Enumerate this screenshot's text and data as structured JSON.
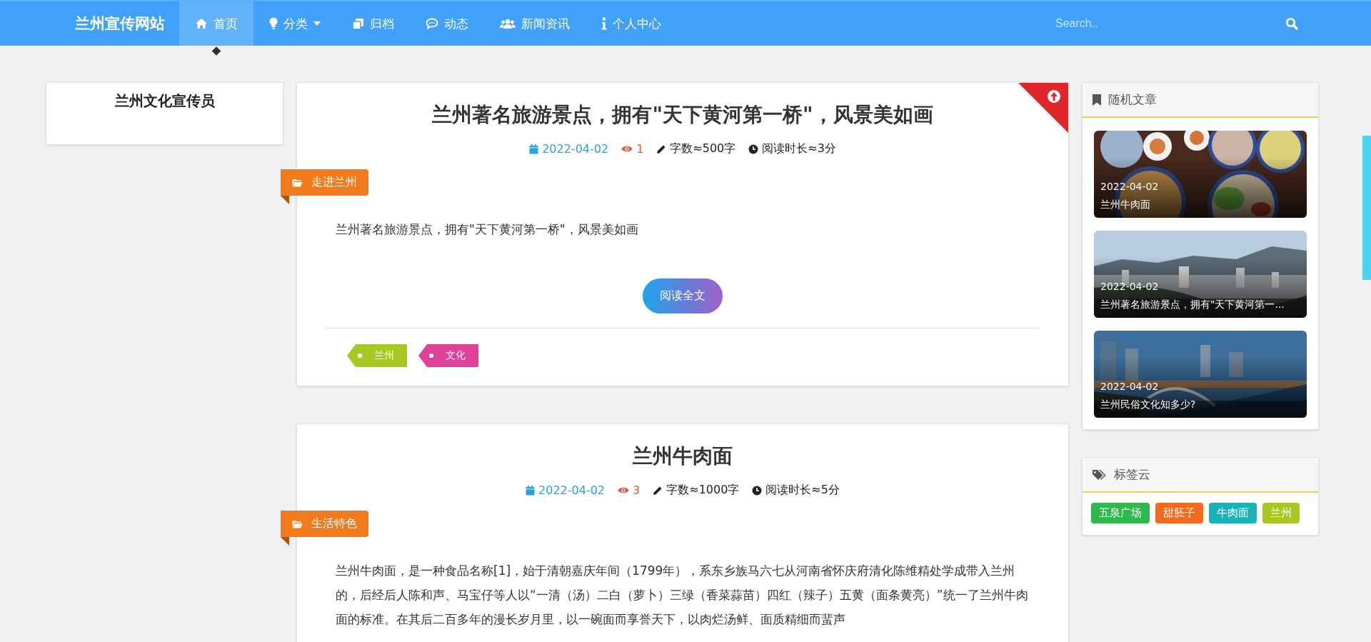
{
  "navbar": {
    "brand": "兰州宣传网站",
    "items": [
      {
        "label": "首页",
        "selected": true,
        "dropdown": false
      },
      {
        "label": "分类",
        "selected": false,
        "dropdown": true
      },
      {
        "label": "归档",
        "selected": false,
        "dropdown": false
      },
      {
        "label": "动态",
        "selected": false,
        "dropdown": false
      },
      {
        "label": "新闻资讯",
        "selected": false,
        "dropdown": false
      },
      {
        "label": "个人中心",
        "selected": false,
        "dropdown": false
      }
    ],
    "search": {
      "placeholder": "Search.."
    }
  },
  "profile": {
    "name": "兰州文化宣传员"
  },
  "articles": [
    {
      "title": "兰州著名旅游景点，拥有\"天下黄河第一桥\"，风景美如画",
      "pinned": true,
      "date": "2022-04-02",
      "views": "1",
      "words": "字数≈500字",
      "reading_time": "阅读时长≈3分",
      "category": "走进兰州",
      "excerpt": "兰州著名旅游景点，拥有\"天下黄河第一桥\"，风景美如画",
      "button": "阅读全文",
      "tags": [
        {
          "label": "兰州",
          "color": "#a8c720"
        },
        {
          "label": "文化",
          "color": "#e0409a"
        }
      ]
    },
    {
      "title": "兰州牛肉面",
      "pinned": false,
      "date": "2022-04-02",
      "views": "3",
      "words": "字数≈1000字",
      "reading_time": "阅读时长≈5分",
      "category": "生活特色",
      "excerpt": "兰州牛肉面，是一种食品名称[1]，始于清朝嘉庆年间（1799年），系东乡族马六七从河南省怀庆府清化陈维精处学成带入兰州的，后经后人陈和声、马宝仔等人以“一清（汤）二白（萝卜）三绿（香菜蒜苗）四红（辣子）五黄（面条黄亮）”统一了兰州牛肉面的标准。在其后二百多年的漫长岁月里，以一碗面而享誉天下，以肉烂汤鲜、面质精细而蜚声"
    }
  ],
  "random_posts": {
    "title": "随机文章",
    "items": [
      {
        "kind": "food",
        "date": "2022-04-02",
        "title": "兰州牛肉面"
      },
      {
        "kind": "mountains",
        "date": "2022-04-02",
        "title": "兰州著名旅游景点，拥有\"天下黄河第一..."
      },
      {
        "kind": "river",
        "date": "2022-04-02",
        "title": "兰州民俗文化知多少?"
      }
    ]
  },
  "tag_cloud": {
    "title": "标签云",
    "tags": [
      {
        "label": "五泉广场",
        "color": "#2eb84e"
      },
      {
        "label": "甜胚子",
        "color": "#f26a1e"
      },
      {
        "label": "牛肉面",
        "color": "#17b3b8"
      },
      {
        "label": "兰州",
        "color": "#a8c720"
      }
    ]
  }
}
